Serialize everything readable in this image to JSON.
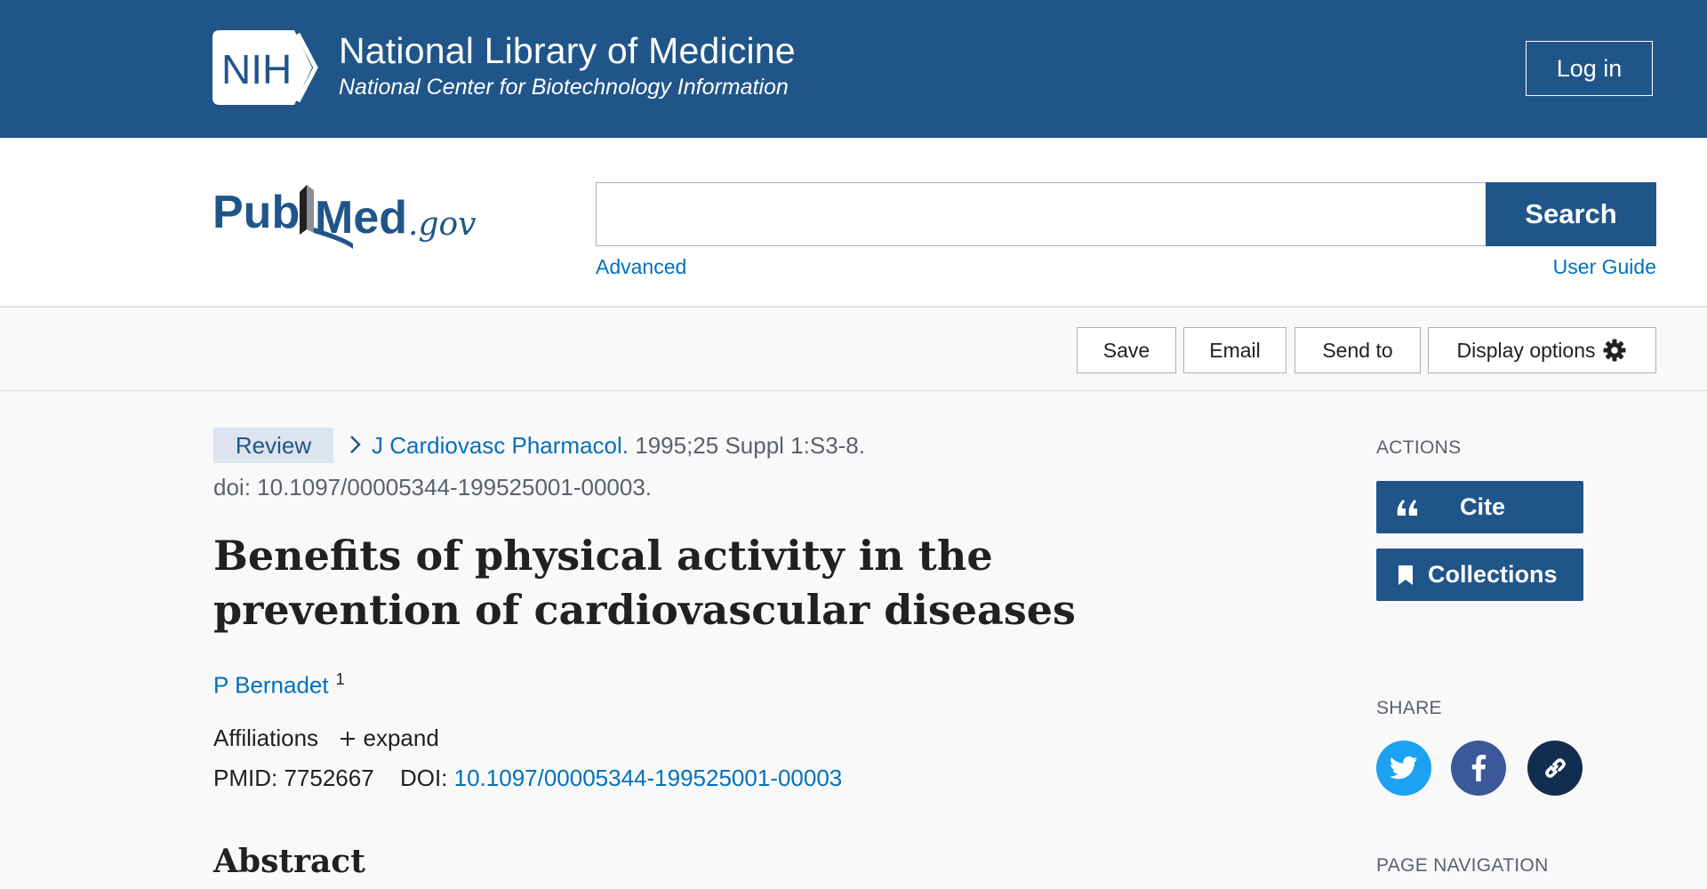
{
  "header": {
    "logo_text": "NIH",
    "title": "National Library of Medicine",
    "subtitle": "National Center for Biotechnology Information",
    "login_label": "Log in"
  },
  "search": {
    "logo": {
      "part1": "Pub",
      "part2": "Med",
      "suffix": ".gov"
    },
    "query": "",
    "button_label": "Search",
    "advanced_label": "Advanced",
    "user_guide_label": "User Guide"
  },
  "toolbar": {
    "save_label": "Save",
    "email_label": "Email",
    "send_to_label": "Send to",
    "display_options_label": "Display options"
  },
  "article": {
    "type_badge": "Review",
    "journal": "J Cardiovasc Pharmacol.",
    "citation": "1995;25 Suppl 1:S3-8.",
    "doi_line": "doi: 10.1097/00005344-199525001-00003.",
    "title": "Benefits of physical activity in the prevention of cardiovascular diseases",
    "author": "P Bernadet",
    "author_affil_ref": "1",
    "affiliations_label": "Affiliations",
    "expand_label": "expand",
    "pmid_label": "PMID:",
    "pmid": "7752667",
    "doi_label": "DOI:",
    "doi": "10.1097/00005344-199525001-00003",
    "abstract_heading": "Abstract"
  },
  "sidebar": {
    "actions_label": "ACTIONS",
    "cite_label": "Cite",
    "collections_label": "Collections",
    "share_label": "SHARE",
    "page_navigation_label": "PAGE NAVIGATION"
  },
  "colors": {
    "nih_blue": "#20558a",
    "link_blue": "#0071bc",
    "twitter": "#1da1f2",
    "facebook": "#3b5998",
    "permalink": "#112e51",
    "review_badge_bg": "#dce4ef"
  }
}
